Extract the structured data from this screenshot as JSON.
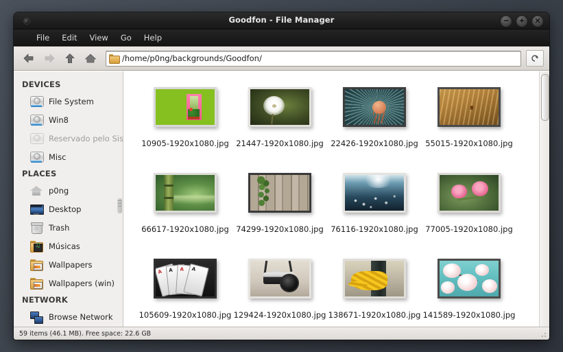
{
  "window": {
    "title": "Goodfon - File Manager",
    "minimize_label": "−",
    "maximize_label": "+",
    "close_label": "×"
  },
  "menu": {
    "items": [
      "File",
      "Edit",
      "View",
      "Go",
      "Help"
    ]
  },
  "toolbar": {
    "back_tooltip": "Back",
    "forward_tooltip": "Forward",
    "up_tooltip": "Up",
    "home_tooltip": "Home",
    "reload_tooltip": "Reload",
    "path": "/home/p0ng/backgrounds/Goodfon/",
    "folder_icon": "folder-icon"
  },
  "sidebar": {
    "groups": [
      {
        "title": "DEVICES",
        "items": [
          {
            "label": "File System",
            "icon": "drive-icon",
            "dim": false
          },
          {
            "label": "Win8",
            "icon": "drive-icon",
            "dim": false
          },
          {
            "label": "Reservado pelo Sis...",
            "icon": "drive-icon",
            "dim": true
          },
          {
            "label": "Misc",
            "icon": "drive-icon",
            "dim": false
          }
        ]
      },
      {
        "title": "PLACES",
        "items": [
          {
            "label": "p0ng",
            "icon": "home-icon",
            "dim": false
          },
          {
            "label": "Desktop",
            "icon": "desktop-icon",
            "dim": false
          },
          {
            "label": "Trash",
            "icon": "trash-icon",
            "dim": false
          },
          {
            "label": "Músicas",
            "icon": "music-folder-icon",
            "dim": false
          },
          {
            "label": "Wallpapers",
            "icon": "pictures-folder-icon",
            "dim": false
          },
          {
            "label": "Wallpapers (win)",
            "icon": "pictures-folder-icon",
            "dim": false
          }
        ]
      },
      {
        "title": "NETWORK",
        "items": [
          {
            "label": "Browse Network",
            "icon": "network-icon",
            "dim": false
          }
        ]
      }
    ]
  },
  "files": [
    {
      "name": "10905-1920x1080.jpg",
      "art": "art-window",
      "frame": "light"
    },
    {
      "name": "21447-1920x1080.jpg",
      "art": "art-dandelion",
      "frame": "light"
    },
    {
      "name": "22426-1920x1080.jpg",
      "art": "art-teal",
      "frame": "dark"
    },
    {
      "name": "55015-1920x1080.jpg",
      "art": "art-wheat",
      "frame": "dark"
    },
    {
      "name": "66617-1920x1080.jpg",
      "art": "art-bamboo",
      "frame": "light"
    },
    {
      "name": "74299-1920x1080.jpg",
      "art": "art-fence",
      "frame": "dark"
    },
    {
      "name": "76116-1920x1080.jpg",
      "art": "art-water",
      "frame": "light"
    },
    {
      "name": "77005-1920x1080.jpg",
      "art": "art-pinkflower",
      "frame": "light"
    },
    {
      "name": "105609-1920x1080.jpg",
      "art": "art-cards",
      "frame": "dark"
    },
    {
      "name": "129424-1920x1080.jpg",
      "art": "art-camera",
      "frame": "light"
    },
    {
      "name": "138671-1920x1080.jpg",
      "art": "art-rope",
      "frame": "light"
    },
    {
      "name": "141589-1920x1080.jpg",
      "art": "art-blossom",
      "frame": "dark"
    }
  ],
  "statusbar": {
    "text": "59 items (46.1 MB). Free space: 22.6 GB"
  }
}
